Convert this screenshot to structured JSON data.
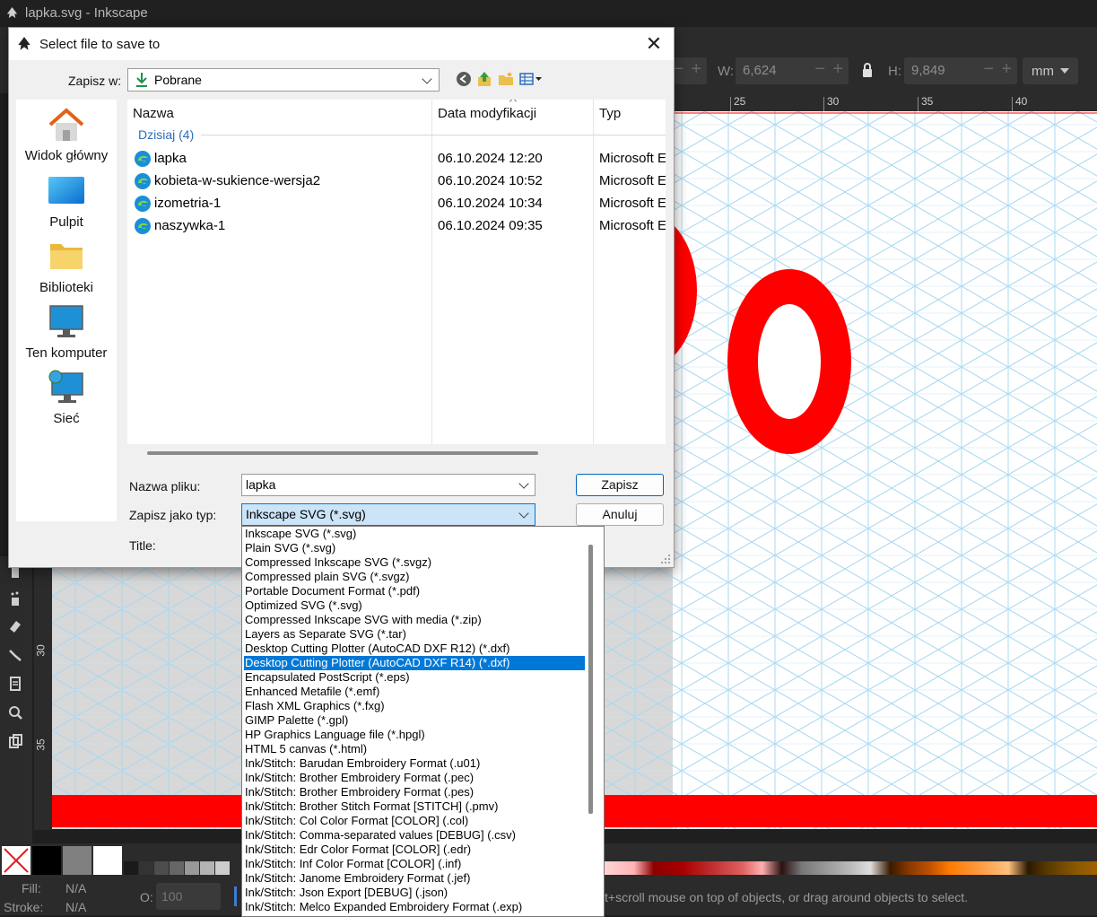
{
  "app": {
    "title": "lapka.svg - Inkscape",
    "toolbar": {
      "w_label": "W:",
      "w_value": "6,624",
      "h_label": "H:",
      "h_value": "9,849",
      "unit": "mm"
    },
    "ruler_top": [
      "25",
      "30",
      "35",
      "40"
    ],
    "ruler_left": [
      "30",
      "35"
    ],
    "status": {
      "fill_label": "Fill:",
      "fill_value": "N/A",
      "stroke_label": "Stroke:",
      "stroke_value": "N/A",
      "opacity_label": "O:",
      "opacity_value": "100",
      "hint": "t+scroll mouse on top of objects, or drag around objects to select."
    },
    "colors": {
      "accent_red": "#ff0000",
      "grid": "#9fd3ef",
      "selection": "#0078d7"
    }
  },
  "dialog": {
    "title": "Select file to save to",
    "save_in_label": "Zapisz w:",
    "save_in_value": "Pobrane",
    "places": [
      {
        "label": "Widok główny",
        "icon": "home-icon"
      },
      {
        "label": "Pulpit",
        "icon": "desktop-icon"
      },
      {
        "label": "Biblioteki",
        "icon": "libraries-icon"
      },
      {
        "label": "Ten komputer",
        "icon": "computer-icon"
      },
      {
        "label": "Sieć",
        "icon": "network-icon"
      }
    ],
    "columns": {
      "name": "Nazwa",
      "date": "Data modyfikacji",
      "type": "Typ"
    },
    "group_header": "Dzisiaj (4)",
    "files": [
      {
        "name": "lapka",
        "date": "06.10.2024 12:20",
        "type": "Microsoft E"
      },
      {
        "name": "kobieta-w-sukience-wersja2",
        "date": "06.10.2024 10:52",
        "type": "Microsoft E"
      },
      {
        "name": "izometria-1",
        "date": "06.10.2024 10:34",
        "type": "Microsoft E"
      },
      {
        "name": "naszywka-1",
        "date": "06.10.2024 09:35",
        "type": "Microsoft E"
      }
    ],
    "filename_label": "Nazwa pliku:",
    "filename_value": "lapka",
    "type_label": "Zapisz jako typ:",
    "type_value": "Inkscape SVG (*.svg)",
    "title_label": "Title:",
    "save_button": "Zapisz",
    "cancel_button": "Anuluj",
    "type_options": [
      "Inkscape SVG (*.svg)",
      "Plain SVG (*.svg)",
      "Compressed Inkscape SVG (*.svgz)",
      "Compressed plain SVG (*.svgz)",
      "Portable Document Format (*.pdf)",
      "Optimized SVG (*.svg)",
      "Compressed Inkscape SVG with media (*.zip)",
      "Layers as Separate SVG (*.tar)",
      "Desktop Cutting Plotter (AutoCAD DXF R12) (*.dxf)",
      "Desktop Cutting Plotter (AutoCAD DXF R14) (*.dxf)",
      "Encapsulated PostScript (*.eps)",
      "Enhanced Metafile (*.emf)",
      "Flash XML Graphics (*.fxg)",
      "GIMP Palette (*.gpl)",
      "HP Graphics Language file (*.hpgl)",
      "HTML 5 canvas (*.html)",
      "Ink/Stitch: Barudan Embroidery Format (.u01)",
      "Ink/Stitch: Brother Embroidery Format (.pec)",
      "Ink/Stitch: Brother Embroidery Format (.pes)",
      "Ink/Stitch: Brother Stitch Format [STITCH] (.pmv)",
      "Ink/Stitch: Col Color Format [COLOR] (.col)",
      "Ink/Stitch: Comma-separated values [DEBUG] (.csv)",
      "Ink/Stitch: Edr Color Format [COLOR] (.edr)",
      "Ink/Stitch: Inf Color Format [COLOR] (.inf)",
      "Ink/Stitch: Janome Embroidery Format (.jef)",
      "Ink/Stitch: Json Export [DEBUG] (.json)",
      "Ink/Stitch: Melco Expanded Embroidery Format (.exp)"
    ],
    "selected_option_index": 9
  }
}
